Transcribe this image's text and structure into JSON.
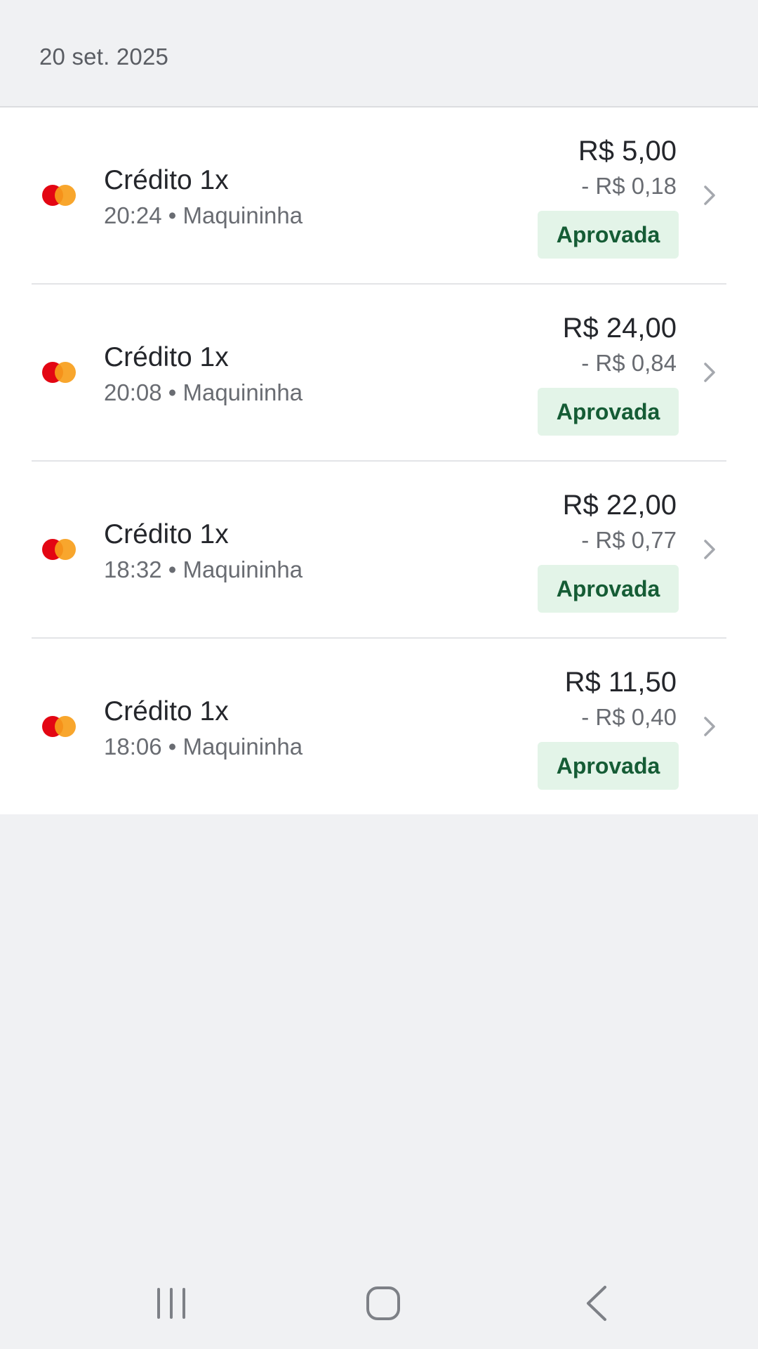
{
  "date_header": "20 set. 2025",
  "transactions": [
    {
      "title": "Crédito 1x",
      "time": "20:24",
      "channel": "Maquininha",
      "amount": "R$ 5,00",
      "fee": "- R$ 0,18",
      "status": "Aprovada"
    },
    {
      "title": "Crédito 1x",
      "time": "20:08",
      "channel": "Maquininha",
      "amount": "R$ 24,00",
      "fee": "- R$ 0,84",
      "status": "Aprovada"
    },
    {
      "title": "Crédito 1x",
      "time": "18:32",
      "channel": "Maquininha",
      "amount": "R$ 22,00",
      "fee": "- R$ 0,77",
      "status": "Aprovada"
    },
    {
      "title": "Crédito 1x",
      "time": "18:06",
      "channel": "Maquininha",
      "amount": "R$ 11,50",
      "fee": "- R$ 0,40",
      "status": "Aprovada"
    }
  ],
  "card_brand_icon": "mastercard-icon",
  "colors": {
    "status_bg": "#e3f4e8",
    "status_text": "#155c35",
    "mastercard_red": "#e30613",
    "mastercard_orange": "#f79e1b"
  },
  "nav": {
    "recents_icon": "recent-apps-icon",
    "home_icon": "home-icon",
    "back_icon": "back-icon"
  }
}
